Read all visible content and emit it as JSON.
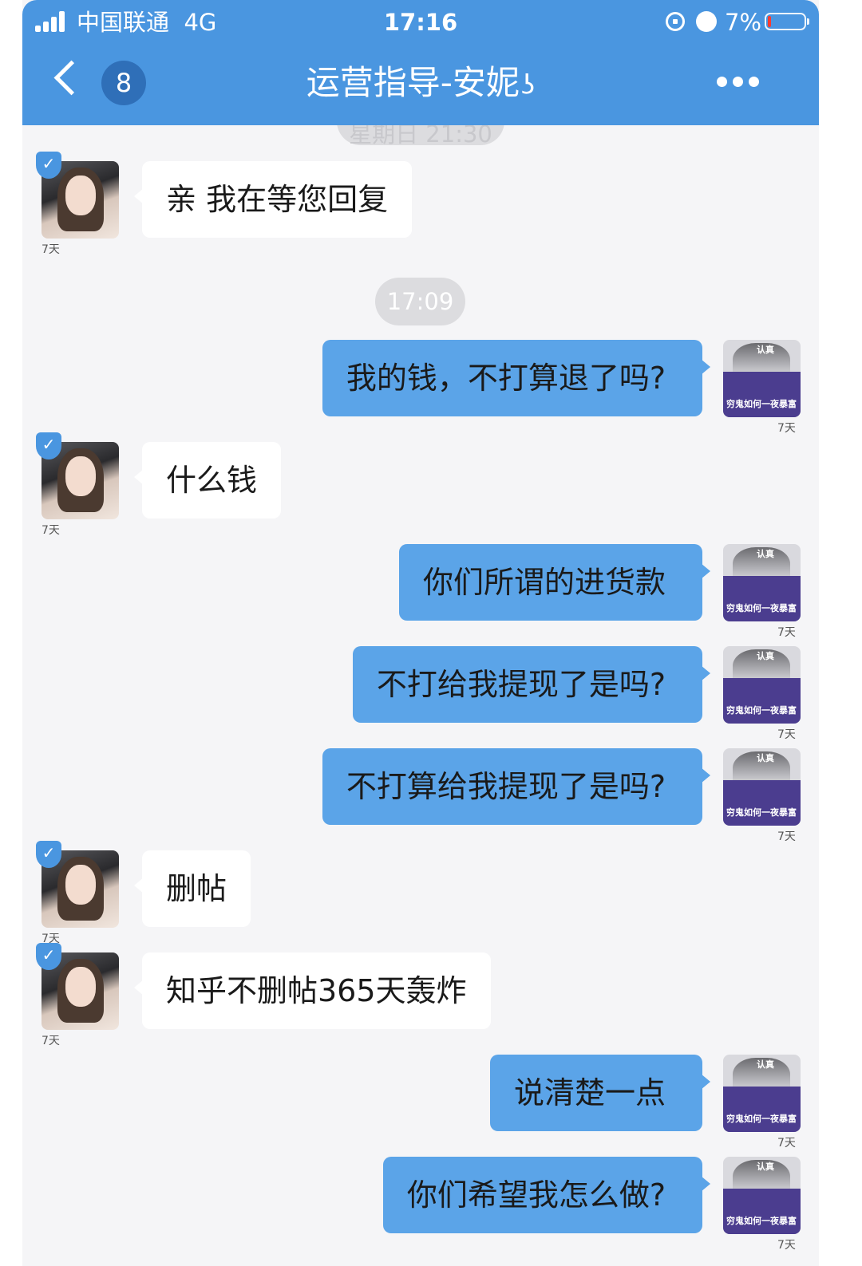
{
  "status_bar": {
    "carrier": "中国联通",
    "network": "4G",
    "time": "17:16",
    "battery": "7%"
  },
  "header": {
    "unread_count": "8",
    "title": "运营指导-安妮",
    "earpiece_icon": "ear-icon",
    "more_icon": "more-dots-icon"
  },
  "colors": {
    "header": "#4a96e0",
    "outgoing_bubble": "#5ba4e8",
    "incoming_bubble": "#ffffff",
    "background": "#f5f5f7"
  },
  "timestamps": {
    "top_partial": "星期日 21:30",
    "middle": "17:09"
  },
  "contact": {
    "tag": "7天",
    "badge_icon": "verified-shield-icon"
  },
  "self": {
    "tag": "7天",
    "avatar_seal": "认真",
    "avatar_caption": "穷鬼如何一夜暴富"
  },
  "messages": [
    {
      "side": "left",
      "text": "亲 我在等您回复"
    },
    {
      "side": "right",
      "text": "我的钱，不打算退了吗?"
    },
    {
      "side": "left",
      "text": "什么钱"
    },
    {
      "side": "right",
      "text": "你们所谓的进货款"
    },
    {
      "side": "right",
      "text": "不打给我提现了是吗?"
    },
    {
      "side": "right",
      "text": "不打算给我提现了是吗?"
    },
    {
      "side": "left",
      "text": "删帖"
    },
    {
      "side": "left",
      "text": "知乎不删帖365天轰炸"
    },
    {
      "side": "right",
      "text": "说清楚一点"
    },
    {
      "side": "right",
      "text": "你们希望我怎么做?"
    }
  ]
}
